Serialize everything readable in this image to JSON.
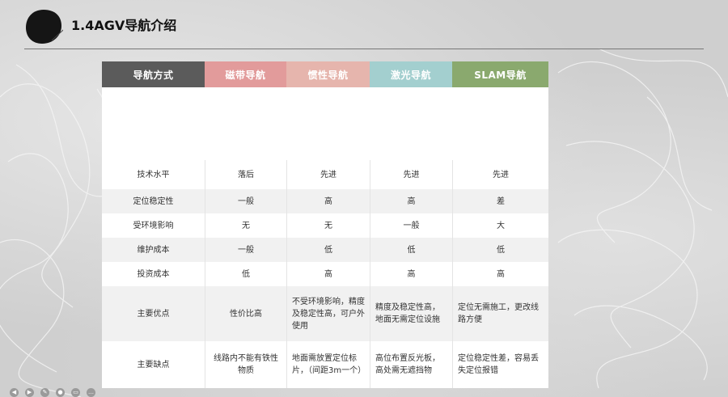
{
  "slide": {
    "title": "1.4AGV导航介绍"
  },
  "table": {
    "headers": [
      {
        "label": "导航方式",
        "color": "#5b5b5b"
      },
      {
        "label": "磁带导航",
        "color": "#e29b9b"
      },
      {
        "label": "惯性导航",
        "color": "#e6b5ad"
      },
      {
        "label": "激光导航",
        "color": "#a3cfcf"
      },
      {
        "label": "SLAM导航",
        "color": "#8aa96e"
      }
    ],
    "rows": [
      [
        "技术水平",
        "落后",
        "先进",
        "先进",
        "先进"
      ],
      [
        "定位稳定性",
        "一般",
        "高",
        "高",
        "差"
      ],
      [
        "受环境影响",
        "无",
        "无",
        "一般",
        "大"
      ],
      [
        "维护成本",
        "一般",
        "低",
        "低",
        "低"
      ],
      [
        "投资成本",
        "低",
        "高",
        "高",
        "高"
      ],
      [
        "主要优点",
        "性价比高",
        "不受环境影响，精度及稳定性高，可户外使用",
        "精度及稳定性高，地面无需定位设施",
        "定位无需施工，更改线路方便"
      ],
      [
        "主要缺点",
        "线路内不能有铁性物质",
        "地面需放置定位标片，（间距3m一个）",
        "高位布置反光板，高处需无遮挡物",
        "定位稳定性差，容易丢失定位报错"
      ]
    ]
  },
  "toolbar": {
    "icons": [
      "prev-icon",
      "next-icon",
      "pen-icon",
      "pointer-icon",
      "screen-icon",
      "more-icon"
    ]
  },
  "colors": {
    "background": "#cfcfcf",
    "title_rule": "#777777"
  }
}
